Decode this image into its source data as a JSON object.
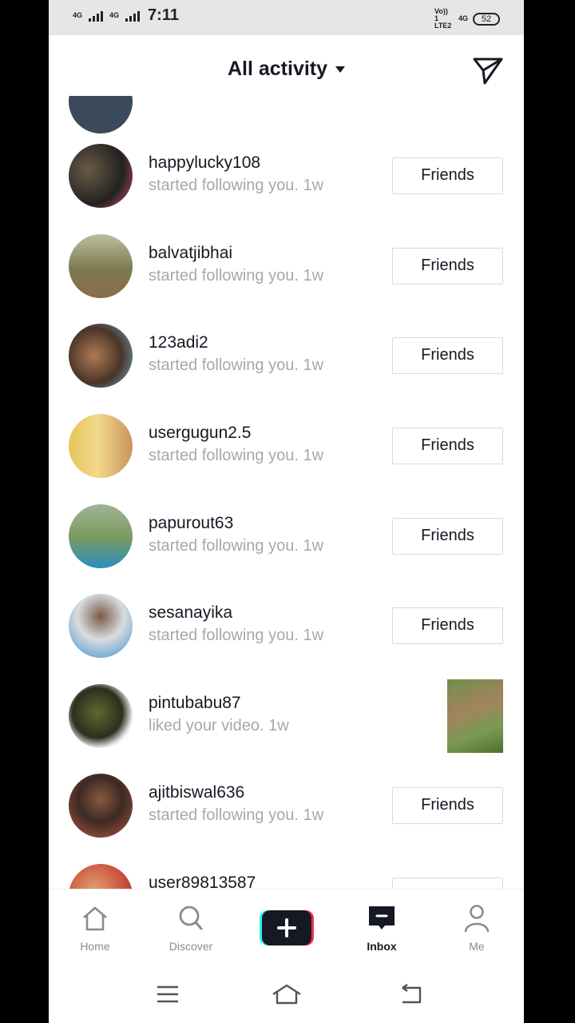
{
  "status_bar": {
    "net1": "4G",
    "net2": "4G",
    "time": "7:11",
    "volte": "Vo)) 1 LTE2",
    "net3": "4G",
    "battery": "52"
  },
  "header": {
    "title": "All activity",
    "send_icon": "paper-plane-icon"
  },
  "activities": [
    {
      "username": "happylucky108",
      "text": "started following you.",
      "time": "1w",
      "action": "Friends"
    },
    {
      "username": "balvatjibhai",
      "text": "started following you.",
      "time": "1w",
      "action": "Friends"
    },
    {
      "username": "123adi2",
      "text": "started following you.",
      "time": "1w",
      "action": "Friends"
    },
    {
      "username": "usergugun2.5",
      "text": "started following you.",
      "time": "1w",
      "action": "Friends"
    },
    {
      "username": "papurout63",
      "text": "started following you.",
      "time": "1w",
      "action": "Friends"
    },
    {
      "username": "sesanayika",
      "text": "started following you.",
      "time": "1w",
      "action": "Friends"
    },
    {
      "username": "pintubabu87",
      "text": "liked your video.",
      "time": "1w",
      "action": ""
    },
    {
      "username": "ajitbiswal636",
      "text": "started following you.",
      "time": "1w",
      "action": "Friends"
    },
    {
      "username": "user89813587",
      "text": "",
      "time": "",
      "action": ""
    }
  ],
  "tabs": [
    {
      "label": "Home",
      "icon": "home-icon"
    },
    {
      "label": "Discover",
      "icon": "search-icon"
    },
    {
      "label": "",
      "icon": "create-plus-icon"
    },
    {
      "label": "Inbox",
      "icon": "inbox-icon"
    },
    {
      "label": "Me",
      "icon": "profile-icon"
    }
  ],
  "colors": {
    "text": "#161823",
    "secondary": "#a7a8ac",
    "accent_cyan": "#25f4ee",
    "accent_pink": "#fe2c55"
  }
}
